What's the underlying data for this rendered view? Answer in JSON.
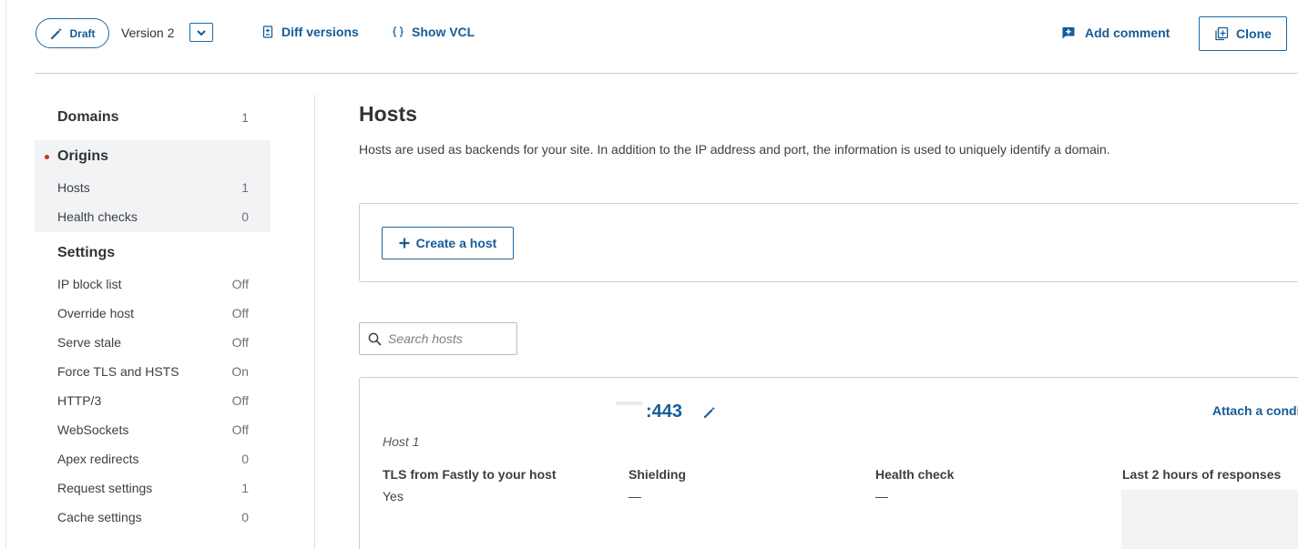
{
  "topbar": {
    "draft_label": "Draft",
    "version_label": "Version 2",
    "diff_label": "Diff versions",
    "vcl_label": "Show VCL",
    "comment_label": "Add comment",
    "clone_label": "Clone"
  },
  "sidebar": {
    "domains": {
      "label": "Domains",
      "count": "1"
    },
    "origins": {
      "label": "Origins",
      "items": [
        {
          "label": "Hosts",
          "value": "1"
        },
        {
          "label": "Health checks",
          "value": "0"
        }
      ]
    },
    "settings": {
      "label": "Settings",
      "items": [
        {
          "label": "IP block list",
          "value": "Off"
        },
        {
          "label": "Override host",
          "value": "Off"
        },
        {
          "label": "Serve stale",
          "value": "Off"
        },
        {
          "label": "Force TLS and HSTS",
          "value": "On"
        },
        {
          "label": "HTTP/3",
          "value": "Off"
        },
        {
          "label": "WebSockets",
          "value": "Off"
        },
        {
          "label": "Apex redirects",
          "value": "0"
        },
        {
          "label": "Request settings",
          "value": "1"
        },
        {
          "label": "Cache settings",
          "value": "0"
        }
      ]
    }
  },
  "main": {
    "title": "Hosts",
    "description": "Hosts are used as backends for your site. In addition to the IP address and port, the information is used to uniquely identify a domain.",
    "create_label": "Create a host",
    "search_placeholder": "Search hosts",
    "host": {
      "port": ":443",
      "name": "Host 1",
      "attach_label": "Attach a condition",
      "columns": [
        {
          "label": "TLS from Fastly to your host",
          "value": "Yes"
        },
        {
          "label": "Shielding",
          "value": "—"
        },
        {
          "label": "Health check",
          "value": "—"
        },
        {
          "label": "Last 2 hours of responses",
          "value": ""
        }
      ]
    }
  },
  "colors": {
    "accent": "#145c99",
    "active_dot": "#d12b2b",
    "sidebar_active_bg": "#f2f3f5"
  }
}
